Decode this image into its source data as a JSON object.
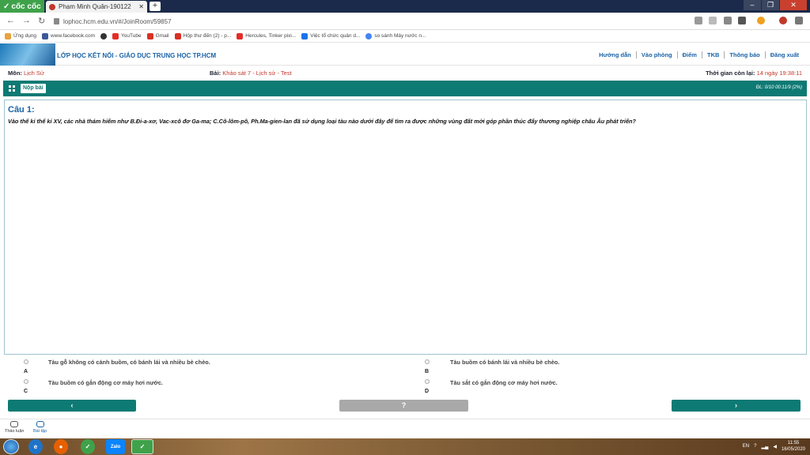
{
  "browser": {
    "brand": "cốc cốc",
    "tab_title": "Phạm Minh Quân-190122",
    "url": "lophoc.hcm.edu.vn/#/JoinRoom/59857",
    "window_controls": [
      "–",
      "❐",
      "✕"
    ]
  },
  "bookmarks": [
    {
      "label": "Ứng dụng",
      "icon": "apps-icon",
      "color": "#e8a33d"
    },
    {
      "label": "www.facebook.com",
      "icon": "facebook-icon",
      "color": "#3b5998"
    },
    {
      "label": "",
      "icon": "github-icon",
      "color": "#333333"
    },
    {
      "label": "YouTube",
      "icon": "youtube-icon",
      "color": "#e52d27"
    },
    {
      "label": "Gmail",
      "icon": "gmail-icon",
      "color": "#d93025"
    },
    {
      "label": "Hộp thư đến (2) - p...",
      "icon": "gmail-icon",
      "color": "#d93025"
    },
    {
      "label": "Hercules, Tinker pixi...",
      "icon": "youtube-icon",
      "color": "#e52d27"
    },
    {
      "label": "Việc tổ chức quản d...",
      "icon": "l-icon",
      "color": "#1a73e8"
    },
    {
      "label": "so sánh Máy nước n...",
      "icon": "google-icon",
      "color": "#4285f4"
    }
  ],
  "site": {
    "name": "LỚP HỌC KẾT NỐI - GIÁO DỤC TRUNG HỌC TP.HCM",
    "nav": [
      "Hướng dẫn",
      "Vào phòng",
      "Điểm",
      "TKB",
      "Thông báo",
      "Đăng xuất"
    ]
  },
  "info": {
    "subject_label": "Môn:",
    "subject": "Lịch Sử",
    "lesson_label": "Bài:",
    "lesson": "Khảo sát 7 - Lịch sử - Test",
    "time_label": "Thời gian còn lại:",
    "time_left": "14 ngày 19:38:11"
  },
  "toolbar": {
    "submit_label": "Nộp bài",
    "progress": "ĐL: 0/10   00:11/9 (2%)"
  },
  "question": {
    "number": "Câu 1:",
    "text": "Vào thế kỉ thế kỉ XV, các nhà thám hiểm như B.Đi-a-xơ, Vac-xcô đơ Ga-ma; C.Cô-lôm-pô, Ph.Ma-gien-lan đã sử dụng loại tàu nào dưới đây để tìm ra được những vùng đất mới góp phần thúc đẩy thương nghiệp châu Âu phát triển?"
  },
  "answers": [
    {
      "letter": "A",
      "text": "Tàu gỗ không có cánh buồm, có bánh lái và nhiều bè chèo."
    },
    {
      "letter": "B",
      "text": "Tàu buồm có bánh lái và nhiều bè chèo."
    },
    {
      "letter": "C",
      "text": "Tàu buồm có gắn động cơ máy hơi nước."
    },
    {
      "letter": "D",
      "text": "Tàu sắt có gắn động cơ máy hơi nước."
    }
  ],
  "nav_buttons": {
    "prev": "‹",
    "help": "?",
    "next": "›"
  },
  "tools": [
    {
      "label": "Thảo luận"
    },
    {
      "label": "Bài tập"
    }
  ],
  "taskbar": {
    "lang": "EN",
    "time": "11:55",
    "date": "16/05/2020",
    "apps": [
      {
        "name": "ie-icon",
        "glyph": "e",
        "color": "#1e73c8"
      },
      {
        "name": "firefox-icon",
        "glyph": "●",
        "color": "#e66000"
      },
      {
        "name": "coccoc-icon",
        "glyph": "✓",
        "color": "#3fa24a"
      },
      {
        "name": "zalo-icon",
        "glyph": "Zalo",
        "color": "#0a84ff"
      },
      {
        "name": "coccoc-active-icon",
        "glyph": "✓",
        "color": "#3fa24a"
      }
    ]
  },
  "colors": {
    "teal": "#0e7a74",
    "brand_blue": "#1a63a7",
    "accent_red": "#c0392b"
  }
}
